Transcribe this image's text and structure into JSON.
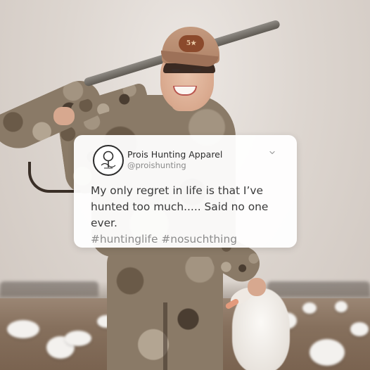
{
  "post": {
    "author_name": "Prois Hunting Apparel",
    "author_handle": "@proishunting",
    "body": "My only regret in life is that I’ve\nhunted too much..... Said no one ever.",
    "hashtags": "#huntinglife #nosuchthing"
  },
  "photo": {
    "cap_patch_text": "5★"
  },
  "icons": {
    "menu": "chevron-down-icon",
    "avatar": "prois-logo"
  },
  "colors": {
    "card_background": "#ffffff",
    "body_text": "#3a3a3a",
    "hashtag_text": "#8c8c8c",
    "handle_text": "#8a8a8a"
  }
}
